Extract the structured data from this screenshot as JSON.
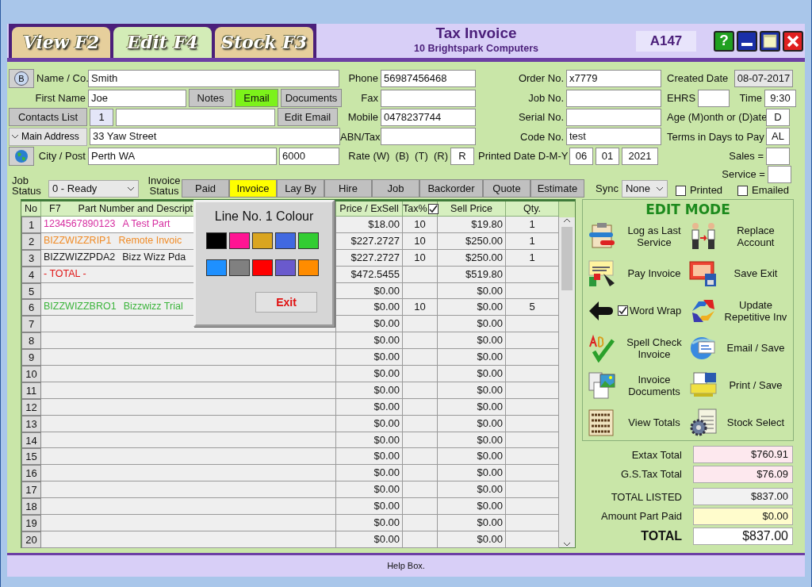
{
  "tabs": [
    {
      "label": "View F2",
      "selected": false
    },
    {
      "label": "Edit F4",
      "selected": true
    },
    {
      "label": "Stock F3",
      "selected": false
    }
  ],
  "header": {
    "title": "Tax Invoice",
    "subtitle": "10 Brightspark Computers",
    "invoice_no": "A147",
    "help_button": "?"
  },
  "customer": {
    "lookup_button": "B",
    "name_label": "Name / Co.",
    "name": "Smith",
    "first_name_label": "First Name",
    "first_name": "Joe",
    "notes_button": "Notes",
    "email_button": {
      "label": "Email",
      "on": true
    },
    "documents_button": "Documents",
    "contacts_button": "Contacts List",
    "contact_index": "1",
    "edit_email_button": "Edit Email",
    "address_dropdown": "Main Address",
    "address": "33 Yaw Street",
    "city_label": "City / Post",
    "city": "Perth WA",
    "postcode": "6000"
  },
  "contact": [
    {
      "label": "Phone",
      "value": "56987456468"
    },
    {
      "label": "Fax"
    },
    {
      "label": "Mobile",
      "value": "0478237744"
    },
    {
      "label": "ABN/Tax"
    }
  ],
  "rate": {
    "label": "Rate (W)  (B)  (T)  (R)",
    "value": "R"
  },
  "order": [
    {
      "label": "Order No.",
      "value": "x7779"
    },
    {
      "label": "Job No."
    },
    {
      "label": "Serial No."
    },
    {
      "label": "Code No.",
      "value": "test"
    }
  ],
  "printed_date": {
    "label": "Printed Date D-M-Y",
    "day": "06",
    "month": "01",
    "year": "2021"
  },
  "meta": {
    "created_label": "Created Date",
    "created": "08-07-2017",
    "ehrs_label": "EHRS",
    "time_label": "Time",
    "time": "9:30",
    "age_label": "Age (M)onth or (D)ate",
    "age": "D",
    "terms_label": "Terms in Days to Pay",
    "terms": "AL",
    "sales_label": "Sales =",
    "service_label": "Service ="
  },
  "status": {
    "job_status_label": "Job Status",
    "job_status": "0 - Ready",
    "invoice_status_label": "Invoice Status",
    "invoice_status": [
      {
        "label": "Paid",
        "selected": false
      },
      {
        "label": "Invoice",
        "selected": true
      },
      {
        "label": "Lay By",
        "selected": false
      },
      {
        "label": "Hire",
        "selected": false
      },
      {
        "label": "Job",
        "selected": false
      },
      {
        "label": "Backorder",
        "selected": false
      },
      {
        "label": "Quote",
        "selected": false
      },
      {
        "label": "Estimate",
        "selected": false
      }
    ],
    "sync_label": "Sync",
    "sync": "None",
    "printed": {
      "label": "Printed",
      "checked": false
    },
    "emailed": {
      "label": "Emailed",
      "checked": false
    }
  },
  "table": {
    "columns": [
      "No",
      "F7",
      "Part Number and Descript",
      "Price / ExSell",
      "Tax%",
      "Sell Price",
      "Qty."
    ],
    "tax_checked": true,
    "rows": [
      {
        "no": "1",
        "selected": true,
        "part": "1234567890123",
        "description": "A Test Part",
        "color": "#d62ea0",
        "price": "$18.00",
        "tax": "10",
        "sell": "$19.80",
        "qty": "1"
      },
      {
        "no": "2",
        "selected": false,
        "part": "BIZZWIZZRIP1",
        "description": "Remote Invoic",
        "color": "#f08c28",
        "price": "$227.2727",
        "tax": "10",
        "sell": "$250.00",
        "qty": "1"
      },
      {
        "no": "3",
        "selected": false,
        "part": "BIZZWIZZPDA2",
        "description": "Bizz Wizz Pda",
        "color": "#1a1a1a",
        "price": "$227.2727",
        "tax": "10",
        "sell": "$250.00",
        "qty": "1"
      },
      {
        "no": "4",
        "selected": false,
        "part": "- TOTAL -",
        "color": "#e01414",
        "price": "$472.5455",
        "sell": "$519.80"
      },
      {
        "no": "5",
        "selected": false,
        "price": "$0.00",
        "sell": "$0.00"
      },
      {
        "no": "6",
        "selected": false,
        "part": "BIZZWIZZBRO1",
        "description": "Bizzwizz Trial",
        "color": "#3cb43c",
        "price": "$0.00",
        "tax": "10",
        "sell": "$0.00",
        "qty": "5"
      },
      {
        "no": "7",
        "selected": false,
        "price": "$0.00",
        "sell": "$0.00"
      },
      {
        "no": "8",
        "selected": false,
        "price": "$0.00",
        "sell": "$0.00"
      },
      {
        "no": "9",
        "selected": false,
        "price": "$0.00",
        "sell": "$0.00"
      },
      {
        "no": "10",
        "selected": false,
        "price": "$0.00",
        "sell": "$0.00"
      },
      {
        "no": "11",
        "selected": false,
        "price": "$0.00",
        "sell": "$0.00"
      },
      {
        "no": "12",
        "selected": false,
        "price": "$0.00",
        "sell": "$0.00"
      },
      {
        "no": "13",
        "selected": false,
        "price": "$0.00",
        "sell": "$0.00"
      },
      {
        "no": "14",
        "selected": false,
        "price": "$0.00",
        "sell": "$0.00"
      },
      {
        "no": "15",
        "selected": false,
        "price": "$0.00",
        "sell": "$0.00"
      },
      {
        "no": "16",
        "selected": false,
        "price": "$0.00",
        "sell": "$0.00"
      },
      {
        "no": "17",
        "selected": false,
        "price": "$0.00",
        "sell": "$0.00"
      },
      {
        "no": "18",
        "selected": false,
        "price": "$0.00",
        "sell": "$0.00"
      },
      {
        "no": "19",
        "selected": false,
        "price": "$0.00",
        "sell": "$0.00"
      },
      {
        "no": "20",
        "selected": false,
        "price": "$0.00",
        "sell": "$0.00"
      }
    ]
  },
  "colour_popup": {
    "title": "Line No. 1 Colour",
    "swatches": [
      {
        "color": "#000000"
      },
      {
        "color": "#ff1493"
      },
      {
        "color": "#daa520"
      },
      {
        "color": "#4169e1"
      },
      {
        "color": "#32cd32"
      },
      {
        "color": "#1e90ff"
      },
      {
        "color": "#808080"
      },
      {
        "color": "#ff0000"
      },
      {
        "color": "#6a5acd"
      },
      {
        "color": "#ff8c00"
      }
    ],
    "exit_button": "Exit"
  },
  "actions": {
    "title": "EDIT MODE",
    "items": [
      {
        "kind": "button",
        "label": "Log as Last Service"
      },
      {
        "kind": "button",
        "label": "Replace Account"
      },
      {
        "kind": "button",
        "label": "Pay Invoice"
      },
      {
        "kind": "button",
        "label": "Save Exit"
      },
      {
        "kind": "checkbox",
        "label": "Word Wrap",
        "checked": true
      },
      {
        "kind": "button",
        "label": "Update Repetitive Inv"
      },
      {
        "kind": "button",
        "label": "Spell Check Invoice"
      },
      {
        "kind": "button",
        "label": "Email / Save"
      },
      {
        "kind": "button",
        "label": "Invoice Documents"
      },
      {
        "kind": "button",
        "label": "Print / Save"
      },
      {
        "kind": "button",
        "label": "View Totals"
      },
      {
        "kind": "button",
        "label": "Stock Select"
      }
    ]
  },
  "totals": [
    {
      "label": "Extax Total",
      "value": "$760.91",
      "color": "#fde8ee",
      "kind": "normal"
    },
    {
      "label": "G.S.Tax Total",
      "value": "$76.09",
      "color": "#fde8ee",
      "kind": "normal"
    },
    {
      "label": "TOTAL LISTED",
      "value": "$837.00",
      "color": "#f2f2f2",
      "kind": "normal"
    },
    {
      "label": "Amount Part Paid",
      "value": "$0.00",
      "color": "#fffccc",
      "kind": "normal"
    },
    {
      "label": "TOTAL",
      "value": "$837.00",
      "color": "#ffffff",
      "kind": "grand"
    }
  ],
  "help_bar": "Help Box."
}
